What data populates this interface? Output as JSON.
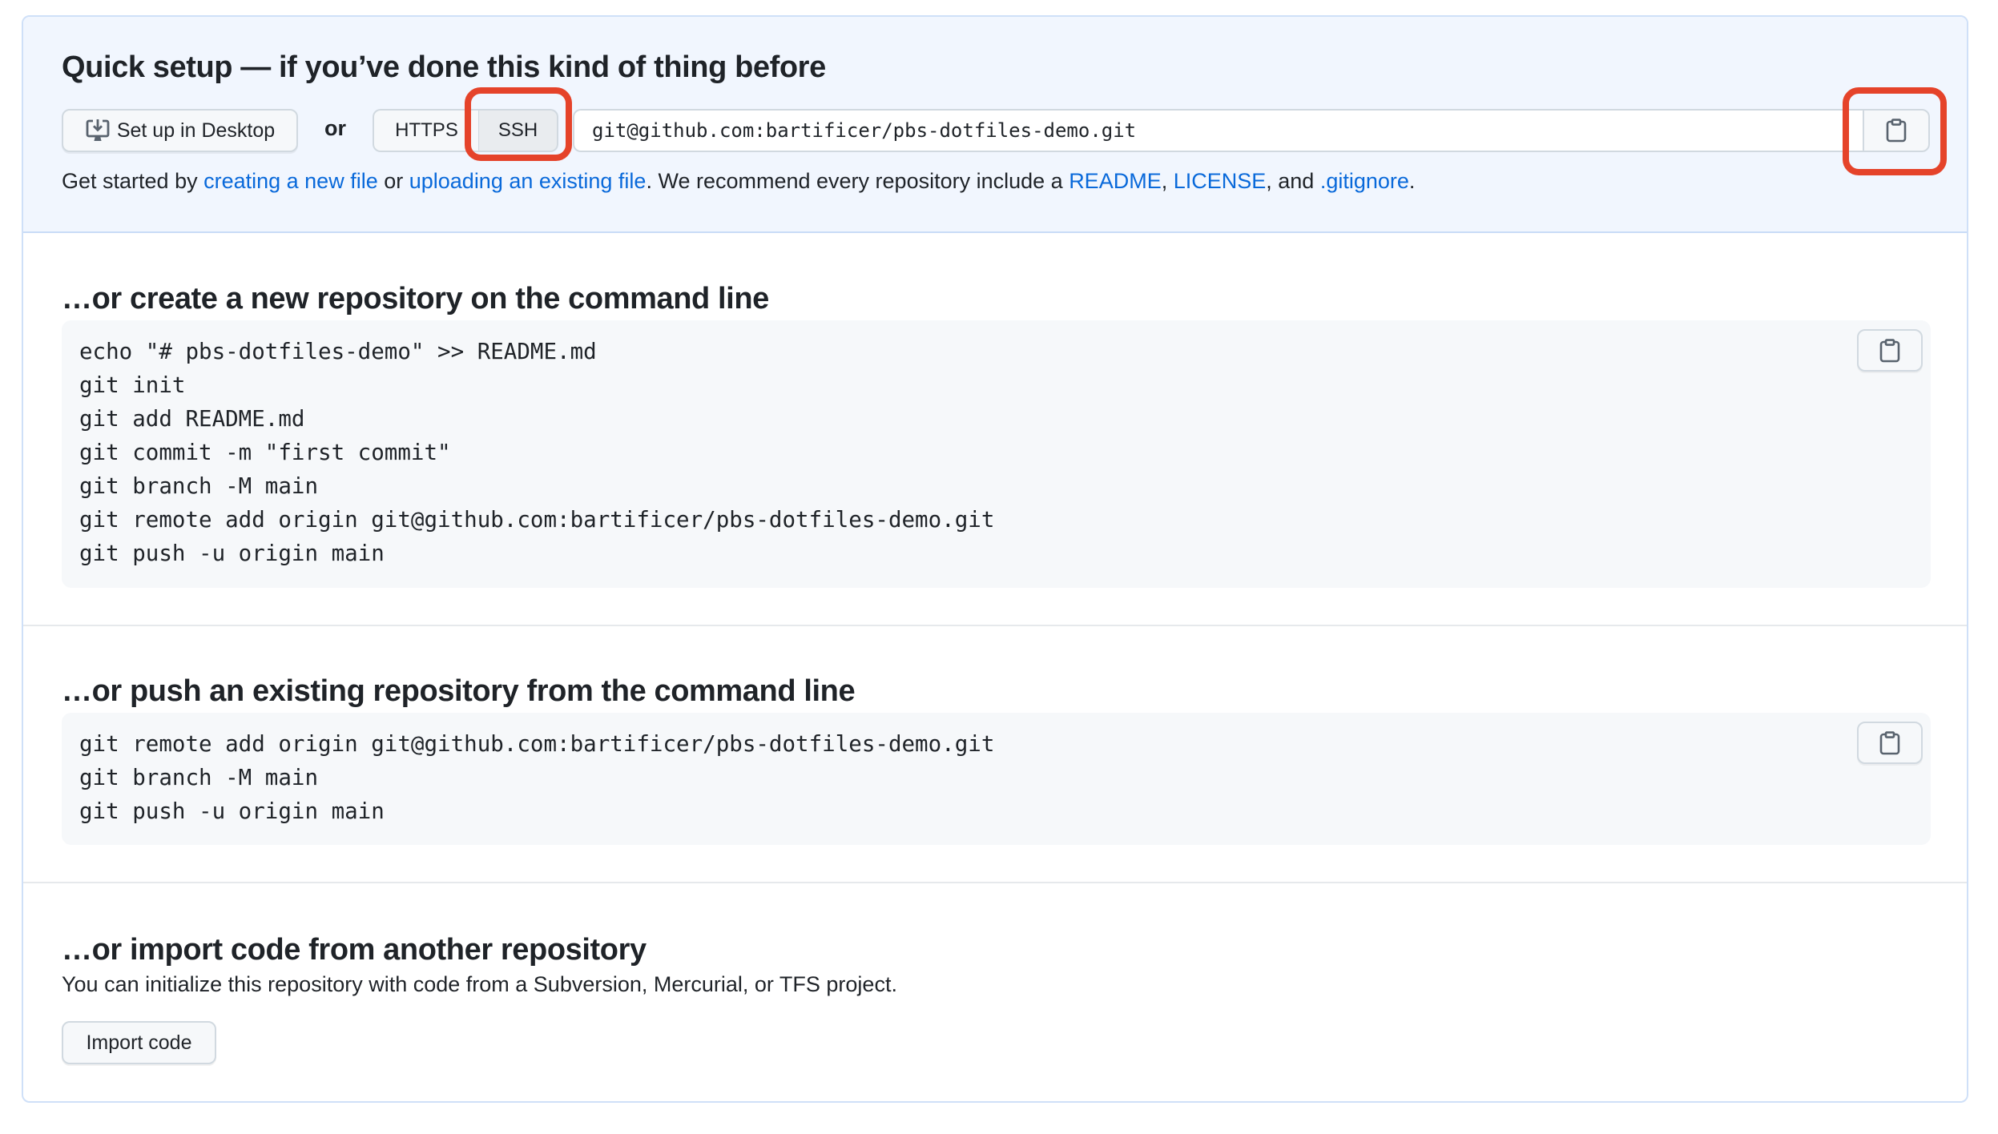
{
  "quick_setup": {
    "title": "Quick setup — if you’ve done this kind of thing before",
    "desktop_button": "Set up in Desktop",
    "or_label": "or",
    "protocols": [
      "HTTPS",
      "SSH"
    ],
    "selected_protocol": "SSH",
    "clone_url": "git@github.com:bartificer/pbs-dotfiles-demo.git",
    "description": {
      "prefix": "Get started by ",
      "link_new_file": "creating a new file",
      "middle": " or ",
      "link_upload": "uploading an existing file",
      "after_upload": ". We recommend every repository include a ",
      "link_readme": "README",
      "comma": ", ",
      "link_license": "LICENSE",
      "and": ", and ",
      "link_gitignore": ".gitignore",
      "end": "."
    }
  },
  "create_section": {
    "title": "…or create a new repository on the command line",
    "lines": [
      "echo \"# pbs-dotfiles-demo\" >> README.md",
      "git init",
      "git add README.md",
      "git commit -m \"first commit\"",
      "git branch -M main",
      "git remote add origin git@github.com:bartificer/pbs-dotfiles-demo.git",
      "git push -u origin main"
    ]
  },
  "push_section": {
    "title": "…or push an existing repository from the command line",
    "lines": [
      "git remote add origin git@github.com:bartificer/pbs-dotfiles-demo.git",
      "git branch -M main",
      "git push -u origin main"
    ]
  },
  "import_section": {
    "title": "…or import code from another repository",
    "description": "You can initialize this repository with code from a Subversion, Mercurial, or TFS project.",
    "button": "Import code"
  },
  "icons": {
    "desktop": "desktop-download-icon",
    "copy": "clipboard-copy-icon"
  },
  "colors": {
    "link": "#0969da",
    "annotation": "#e5432a",
    "quick_setup_bg": "#f1f6fe"
  }
}
